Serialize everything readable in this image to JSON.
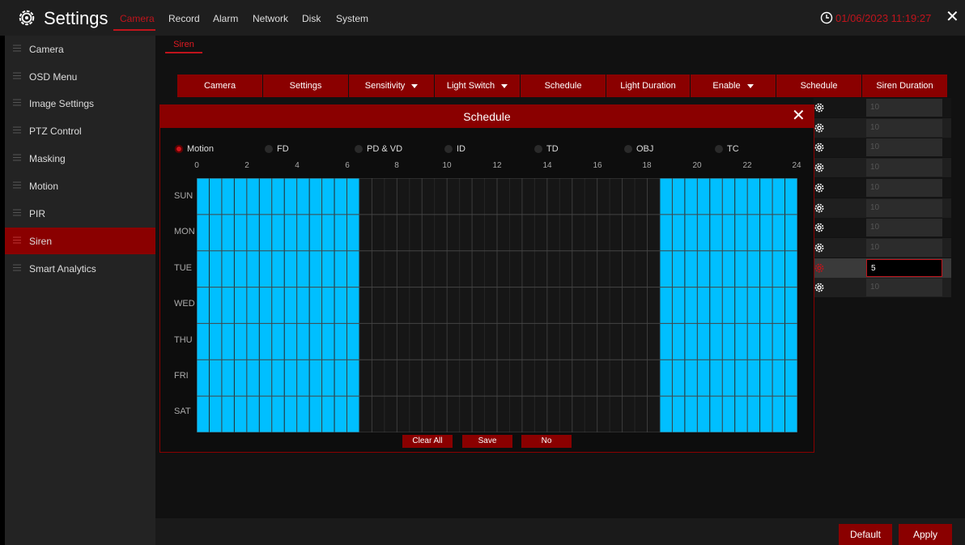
{
  "header": {
    "title": "Settings",
    "tabs": [
      {
        "label": "Camera",
        "active": true
      },
      {
        "label": "Record"
      },
      {
        "label": "Alarm"
      },
      {
        "label": "Network"
      },
      {
        "label": "Disk"
      },
      {
        "label": "System"
      }
    ],
    "datetime": "01/06/2023 11:19:27",
    "accent_color": "#c0141c"
  },
  "sidebar": {
    "items": [
      {
        "label": "Camera"
      },
      {
        "label": "OSD Menu"
      },
      {
        "label": "Image Settings"
      },
      {
        "label": "PTZ Control"
      },
      {
        "label": "Masking"
      },
      {
        "label": "Motion"
      },
      {
        "label": "PIR"
      },
      {
        "label": "Siren",
        "active": true
      },
      {
        "label": "Smart Analytics"
      }
    ]
  },
  "subtab": {
    "label": "Siren"
  },
  "table": {
    "columns": [
      "Camera",
      "Settings",
      "Sensitivity",
      "Light Switch",
      "Schedule",
      "Light Duration",
      "Enable",
      "Schedule",
      "Siren Duration"
    ],
    "siren_durations": [
      "10",
      "10",
      "10",
      "10",
      "10",
      "10",
      "10",
      "10",
      "5",
      "10"
    ],
    "active_row": 8
  },
  "footer": {
    "default_label": "Default",
    "apply_label": "Apply"
  },
  "modal": {
    "title": "Schedule",
    "detection_types": [
      {
        "label": "Motion",
        "selected": true
      },
      {
        "label": "FD"
      },
      {
        "label": "PD & VD"
      },
      {
        "label": "ID"
      },
      {
        "label": "TD"
      },
      {
        "label": "OBJ"
      },
      {
        "label": "TC"
      }
    ],
    "hour_labels": [
      "0",
      "2",
      "4",
      "6",
      "8",
      "10",
      "12",
      "14",
      "16",
      "18",
      "20",
      "22",
      "24"
    ],
    "days": [
      "SUN",
      "MON",
      "TUE",
      "WED",
      "THU",
      "FRI",
      "SAT"
    ],
    "scheduled_hours": [
      [
        0,
        6.5
      ],
      [
        18.5,
        24
      ]
    ],
    "schedule_color": "#00bfff",
    "buttons": {
      "clear_all": "Clear All",
      "save": "Save",
      "no": "No"
    }
  }
}
